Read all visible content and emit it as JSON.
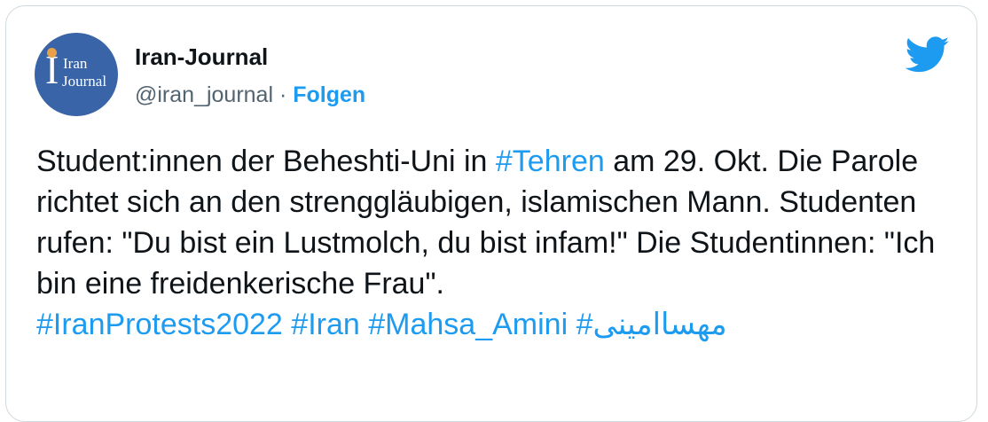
{
  "account": {
    "avatar_line1": "Iran",
    "avatar_line2": "Journal",
    "display_name": "Iran-Journal",
    "handle": "@iran_journal",
    "separator": "·",
    "follow_label": "Folgen"
  },
  "tweet": {
    "text_a": "Student:innen der Beheshti-Uni in ",
    "hashtag_1": "#Tehren",
    "text_b": " am 29. Okt. Die Parole richtet sich an den strenggläubigen, islamischen Mann. Studenten rufen: \"Du bist ein Lustmolch, du bist infam!\" Die Studentinnen: \"Ich bin eine freidenkerische Frau\".",
    "hashtags_line": [
      "#IranProtests2022",
      "#Iran",
      "#Mahsa_Amini",
      "مهساامینی#"
    ]
  },
  "colors": {
    "link": "#1d9bf0",
    "text": "#0f1419",
    "muted": "#536471",
    "avatar_bg": "#3a64a8"
  },
  "icons": {
    "brand": "twitter-bird-icon"
  }
}
